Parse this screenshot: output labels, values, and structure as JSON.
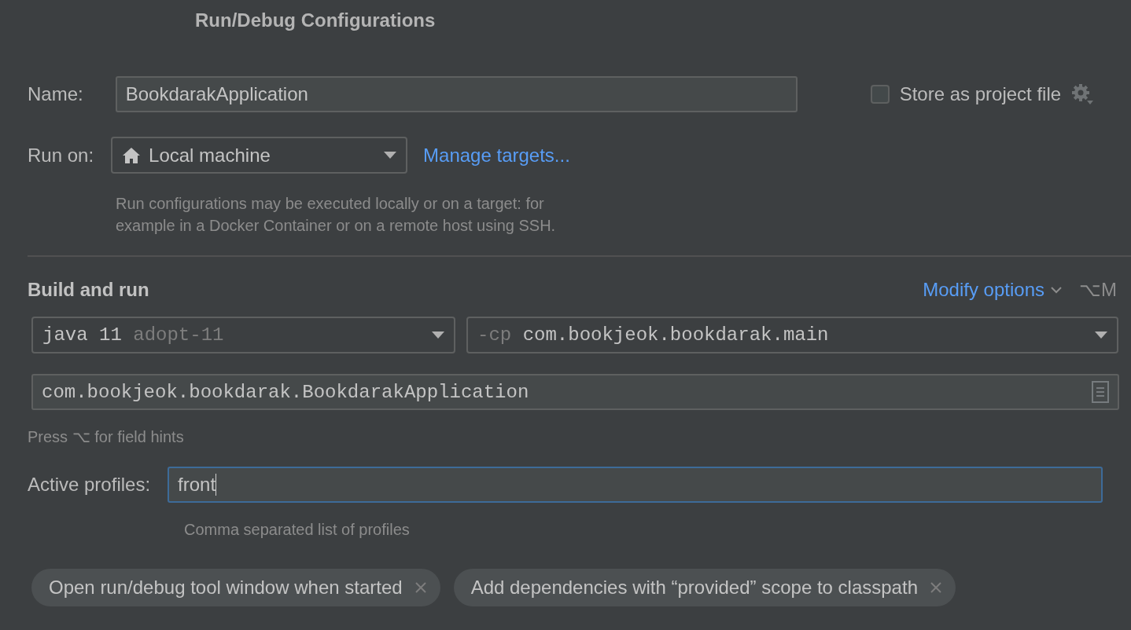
{
  "window": {
    "title": "Run/Debug Configurations"
  },
  "name_row": {
    "label": "Name:",
    "value": "BookdarakApplication"
  },
  "store_as_project_file": {
    "label": "Store as project file",
    "checked": false
  },
  "run_on": {
    "label": "Run on:",
    "value": "Local machine",
    "link": "Manage targets...",
    "help": "Run configurations may be executed locally or on a target: for example in a Docker Container or on a remote host using SSH."
  },
  "build_and_run": {
    "title": "Build and run",
    "modify_options": "Modify options",
    "shortcut": "⌥M",
    "jdk": {
      "value": "java 11",
      "hint": "adopt-11"
    },
    "classpath": {
      "prefix": "-cp",
      "value": "com.bookjeok.bookdarak.main"
    },
    "main_class": "com.bookjeok.bookdarak.BookdarakApplication",
    "field_hint": "Press ⌥ for field hints"
  },
  "active_profiles": {
    "label": "Active profiles:",
    "value": "front",
    "focused": true,
    "help": "Comma separated list of profiles"
  },
  "options": [
    {
      "label": "Open run/debug tool window when started"
    },
    {
      "label": "Add dependencies with “provided” scope to classpath"
    }
  ]
}
